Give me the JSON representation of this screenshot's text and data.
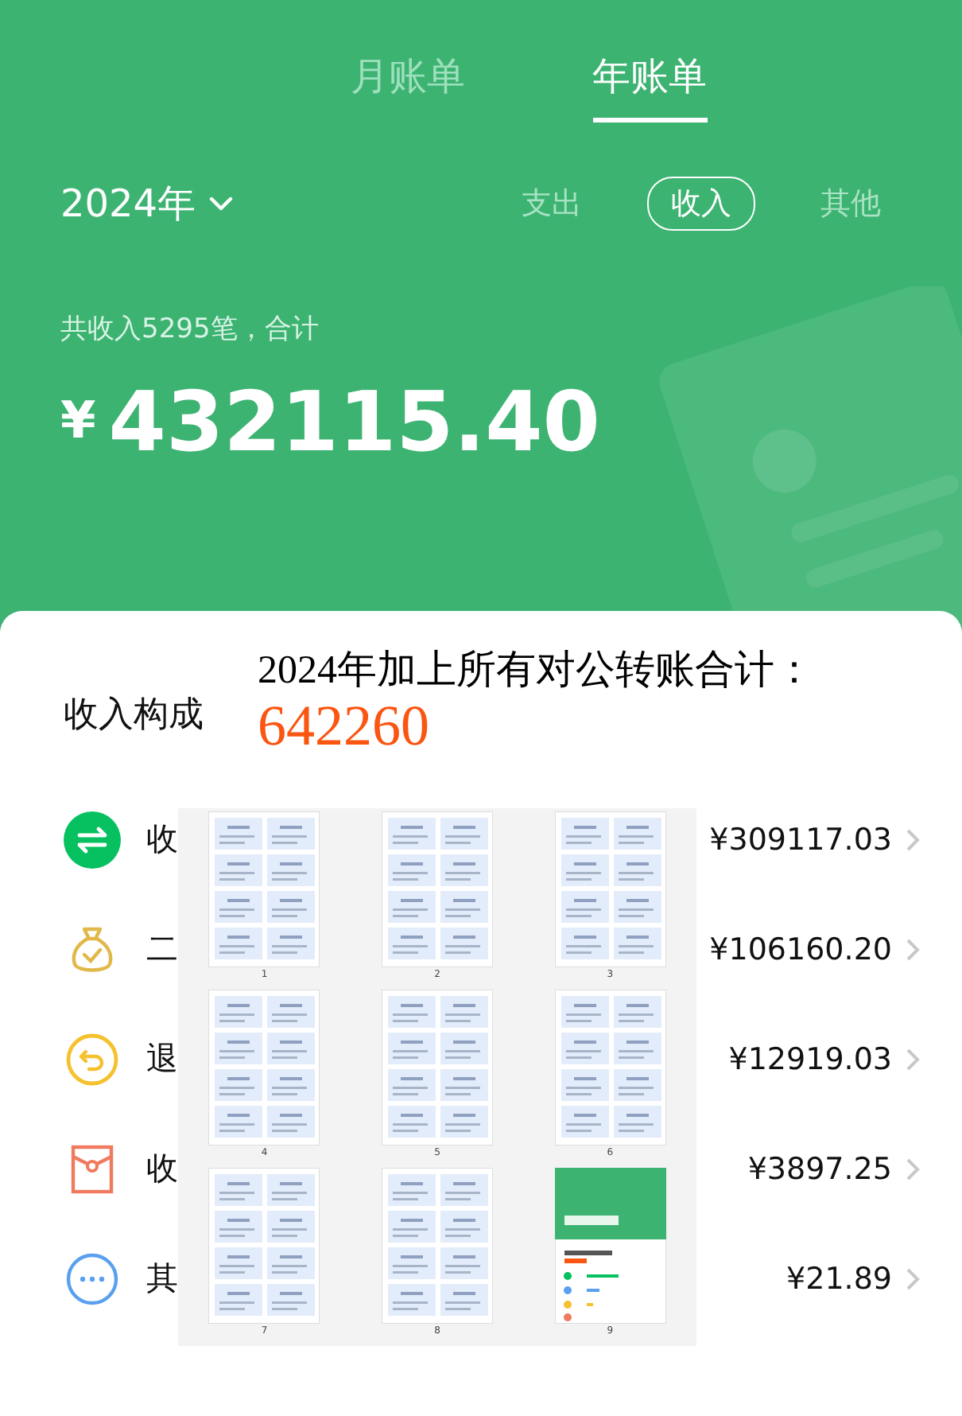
{
  "tabs": [
    {
      "label": "月账单",
      "selected": false
    },
    {
      "label": "年账单",
      "selected": true
    }
  ],
  "year_picker": {
    "label": "2024年"
  },
  "filters": [
    {
      "label": "支出",
      "selected": false
    },
    {
      "label": "收入",
      "selected": true
    },
    {
      "label": "其他",
      "selected": false
    }
  ],
  "summary": {
    "caption": "共收入5295笔，合计",
    "currency": "¥",
    "total": "432115.40"
  },
  "breakdown": {
    "title": "收入构成",
    "rows": [
      {
        "kind": "transfer",
        "label": "收",
        "amount": "¥309117.03"
      },
      {
        "kind": "moneybag",
        "label": "二",
        "amount": "¥106160.20"
      },
      {
        "kind": "refund",
        "label": "退",
        "amount": "¥12919.03"
      },
      {
        "kind": "redpacket",
        "label": "收",
        "amount": "¥3897.25"
      },
      {
        "kind": "other",
        "label": "其",
        "amount": "¥21.89"
      }
    ]
  },
  "overlay_note": {
    "line": "2024年加上所有对公转账合计：",
    "value": "642260"
  },
  "overlay_pages": [
    {
      "number": "1",
      "kind": "document"
    },
    {
      "number": "2",
      "kind": "document"
    },
    {
      "number": "3",
      "kind": "document"
    },
    {
      "number": "4",
      "kind": "document"
    },
    {
      "number": "5",
      "kind": "document"
    },
    {
      "number": "6",
      "kind": "document"
    },
    {
      "number": "7",
      "kind": "document"
    },
    {
      "number": "8",
      "kind": "document"
    },
    {
      "number": "9",
      "kind": "screenshot"
    }
  ]
}
